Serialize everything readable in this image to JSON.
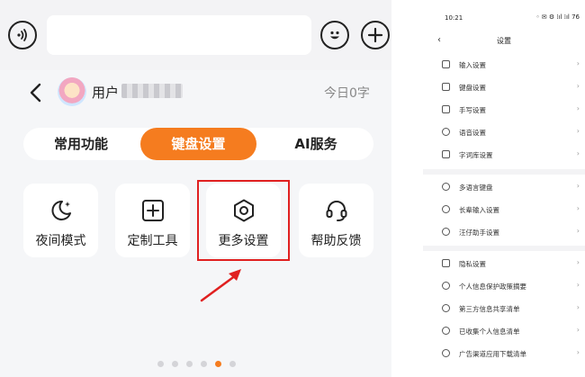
{
  "keyboard": {
    "user_label": "用户",
    "today_count": "今日0字",
    "tabs": [
      {
        "label": "常用功能",
        "active": false
      },
      {
        "label": "键盘设置",
        "active": true
      },
      {
        "label": "AI服务",
        "active": false
      }
    ],
    "cards": [
      {
        "label": "夜间模式",
        "icon": "moon-star-icon"
      },
      {
        "label": "定制工具",
        "icon": "plus-square-icon"
      },
      {
        "label": "更多设置",
        "icon": "hexagon-gear-icon"
      },
      {
        "label": "帮助反馈",
        "icon": "headset-icon"
      }
    ],
    "page_dots": {
      "count": 6,
      "active_index": 4
    },
    "accent_color": "#f57c1f",
    "annotation_color": "#e02020"
  },
  "settings_phone": {
    "status_time": "10:21",
    "status_icons": "◦ ✉ ⚙ ⁞ıl ⁞ıl 76",
    "title": "设置",
    "groups": [
      [
        "输入设置",
        "键盘设置",
        "手写设置",
        "语音设置",
        "字词库设置"
      ],
      [
        "多语言键盘",
        "长辈输入设置",
        "汪仔助手设置"
      ],
      [
        "隐私设置",
        "个人信息保护政策摘要",
        "第三方信息共享清单",
        "已收集个人信息清单",
        "广告渠道应用下载清单"
      ]
    ],
    "chevron": "›"
  }
}
